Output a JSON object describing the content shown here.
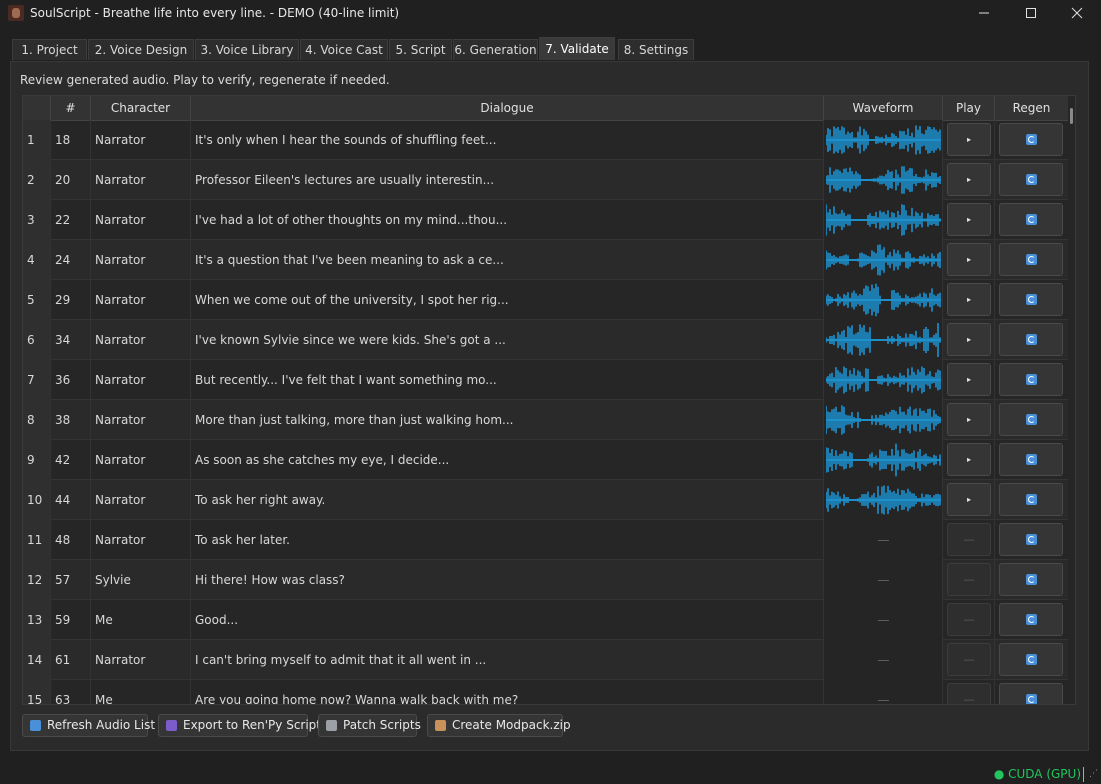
{
  "window": {
    "title": "SoulScript - Breathe life into every line. - DEMO (40-line limit)",
    "minimize_icon": "minimize-icon",
    "maximize_icon": "maximize-icon",
    "close_icon": "close-icon"
  },
  "tabs": [
    {
      "label": "1. Project"
    },
    {
      "label": "2. Voice Design"
    },
    {
      "label": "3. Voice Library"
    },
    {
      "label": "4. Voice Cast"
    },
    {
      "label": "5. Script"
    },
    {
      "label": "6. Generation"
    },
    {
      "label": "7. Validate",
      "active": true
    },
    {
      "label": "8. Settings"
    }
  ],
  "instructions": "Review generated audio. Play to verify, regenerate if needed.",
  "table": {
    "columns": [
      "#",
      "Character",
      "Dialogue",
      "Waveform",
      "Play",
      "Regen"
    ],
    "play_glyph": "▸",
    "empty_glyph": "—",
    "rows": [
      {
        "index": "1",
        "num": "18",
        "character": "Narrator",
        "dialogue": "It's only when I hear the sounds of shuffling feet...",
        "has_audio": true
      },
      {
        "index": "2",
        "num": "20",
        "character": "Narrator",
        "dialogue": "Professor Eileen's lectures are usually interestin...",
        "has_audio": true
      },
      {
        "index": "3",
        "num": "22",
        "character": "Narrator",
        "dialogue": "I've had a lot of other thoughts on my mind...thou...",
        "has_audio": true
      },
      {
        "index": "4",
        "num": "24",
        "character": "Narrator",
        "dialogue": "It's a question that I've been meaning to ask a ce...",
        "has_audio": true
      },
      {
        "index": "5",
        "num": "29",
        "character": "Narrator",
        "dialogue": "When we come out of the university, I spot her rig...",
        "has_audio": true
      },
      {
        "index": "6",
        "num": "34",
        "character": "Narrator",
        "dialogue": "I've known Sylvie since we were kids. She's got a ...",
        "has_audio": true
      },
      {
        "index": "7",
        "num": "36",
        "character": "Narrator",
        "dialogue": "But recently... I've felt that I want something mo...",
        "has_audio": true
      },
      {
        "index": "8",
        "num": "38",
        "character": "Narrator",
        "dialogue": "More than just talking, more than just walking hom...",
        "has_audio": true
      },
      {
        "index": "9",
        "num": "42",
        "character": "Narrator",
        "dialogue": "As soon as she catches my eye, I decide...",
        "has_audio": true
      },
      {
        "index": "10",
        "num": "44",
        "character": "Narrator",
        "dialogue": "To ask her right away.",
        "has_audio": true
      },
      {
        "index": "11",
        "num": "48",
        "character": "Narrator",
        "dialogue": "To ask her later.",
        "has_audio": false
      },
      {
        "index": "12",
        "num": "57",
        "character": "Sylvie",
        "dialogue": "Hi there! How was class?",
        "has_audio": false
      },
      {
        "index": "13",
        "num": "59",
        "character": "Me",
        "dialogue": "Good...",
        "has_audio": false
      },
      {
        "index": "14",
        "num": "61",
        "character": "Narrator",
        "dialogue": "I can't bring myself to admit that it all went in ...",
        "has_audio": false
      },
      {
        "index": "15",
        "num": "63",
        "character": "Me",
        "dialogue": "Are you going home now? Wanna walk back with me?",
        "has_audio": false
      }
    ]
  },
  "bottom_buttons": [
    {
      "label": "Refresh Audio List",
      "icon": "refresh-icon",
      "color": "#4a90d9"
    },
    {
      "label": "Export to Ren'Py Script",
      "icon": "export-icon",
      "color": "#7b5cc9"
    },
    {
      "label": "Patch Scripts",
      "icon": "wrench-icon",
      "color": "#9aa0a6"
    },
    {
      "label": "Create Modpack.zip",
      "icon": "package-icon",
      "color": "#c8925a"
    }
  ],
  "status": {
    "device": "● CUDA (GPU)",
    "color": "#22c55e"
  },
  "colors": {
    "waveform": "#1aa3e8",
    "accent": "#4a90d9"
  }
}
